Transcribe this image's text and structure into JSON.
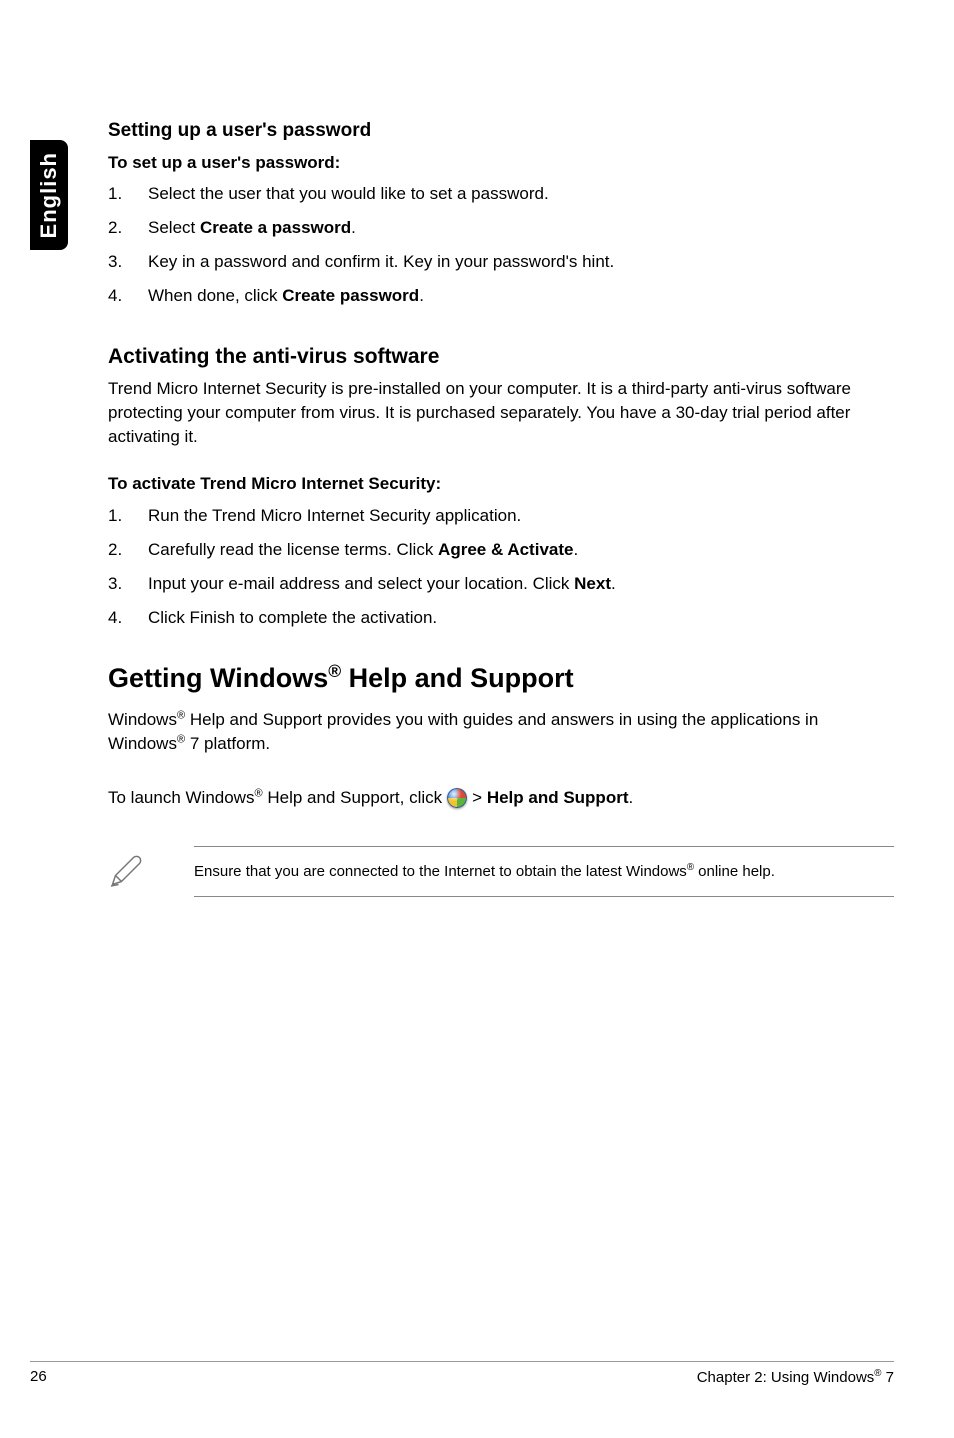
{
  "side_tab": "English",
  "sec1": {
    "heading": "Setting up a user's password",
    "sub": "To set up a user's password:",
    "items": [
      {
        "num": "1.",
        "text_a": "Select the user that you would like to set a password."
      },
      {
        "num": "2.",
        "text_a": "Select ",
        "bold": "Create a password",
        "text_b": "."
      },
      {
        "num": "3.",
        "text_a": "Key in a password and confirm it. Key in your password's hint."
      },
      {
        "num": "4.",
        "text_a": "When done, click ",
        "bold": "Create password",
        "text_b": "."
      }
    ]
  },
  "sec2": {
    "heading": "Activating the anti-virus software",
    "para": "Trend Micro Internet Security is pre-installed on your computer. It is a third-party anti-virus software protecting your computer from virus. It is purchased separately. You have a 30-day trial period after activating it.",
    "sub": "To activate Trend Micro Internet Security:",
    "items": [
      {
        "num": "1.",
        "text_a": "Run the Trend Micro Internet Security application."
      },
      {
        "num": "2.",
        "text_a": "Carefully read the license terms. Click ",
        "bold": "Agree & Activate",
        "text_b": "."
      },
      {
        "num": "3.",
        "text_a": "Input your e-mail address and select your location. Click ",
        "bold": "Next",
        "text_b": "."
      },
      {
        "num": "4.",
        "text_a": "Click Finish to complete the activation."
      }
    ]
  },
  "sec3": {
    "heading_a": "Getting Windows",
    "heading_sup": "®",
    "heading_b": " Help and Support",
    "para_a": "Windows",
    "para_sup1": "®",
    "para_b": " Help and Support provides you with guides and answers in using the applications in Windows",
    "para_sup2": "®",
    "para_c": " 7 platform.",
    "launch_a": "To launch Windows",
    "launch_sup": "®",
    "launch_b": " Help and Support, click ",
    "launch_c": " > ",
    "launch_bold": "Help and Support",
    "launch_d": "."
  },
  "note": {
    "text_a": "Ensure that you are connected to the Internet to obtain the latest Windows",
    "text_sup": "®",
    "text_b": " online help."
  },
  "footer": {
    "page": "26",
    "chapter_a": "Chapter 2: Using Windows",
    "chapter_sup": "®",
    "chapter_b": " 7"
  }
}
